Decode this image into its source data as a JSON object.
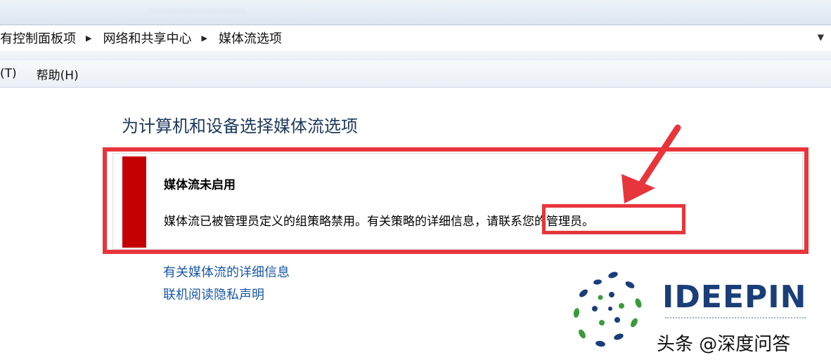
{
  "address": {
    "crumbs": [
      "有控制面板项",
      "网络和共享中心",
      "媒体流选项"
    ],
    "dropdown_glyph": "▼"
  },
  "menubar": {
    "items": [
      "(T)",
      "帮助(H)"
    ]
  },
  "main": {
    "heading": "为计算机和设备选择媒体流选项",
    "panel": {
      "title": "媒体流未启用",
      "message": "媒体流已被管理员定义的组策略禁用。有关策略的详细信息，请联系您的管理员。"
    },
    "links": [
      "有关媒体流的详细信息",
      "联机阅读隐私声明"
    ]
  },
  "overlay": {
    "brand": "IDEEPIN",
    "watermark": "头条 @深度问答",
    "annotation_color": "#e8353b"
  },
  "colors": {
    "error_bar": "#c40004",
    "link": "#1a57a8",
    "heading": "#1e395b"
  }
}
